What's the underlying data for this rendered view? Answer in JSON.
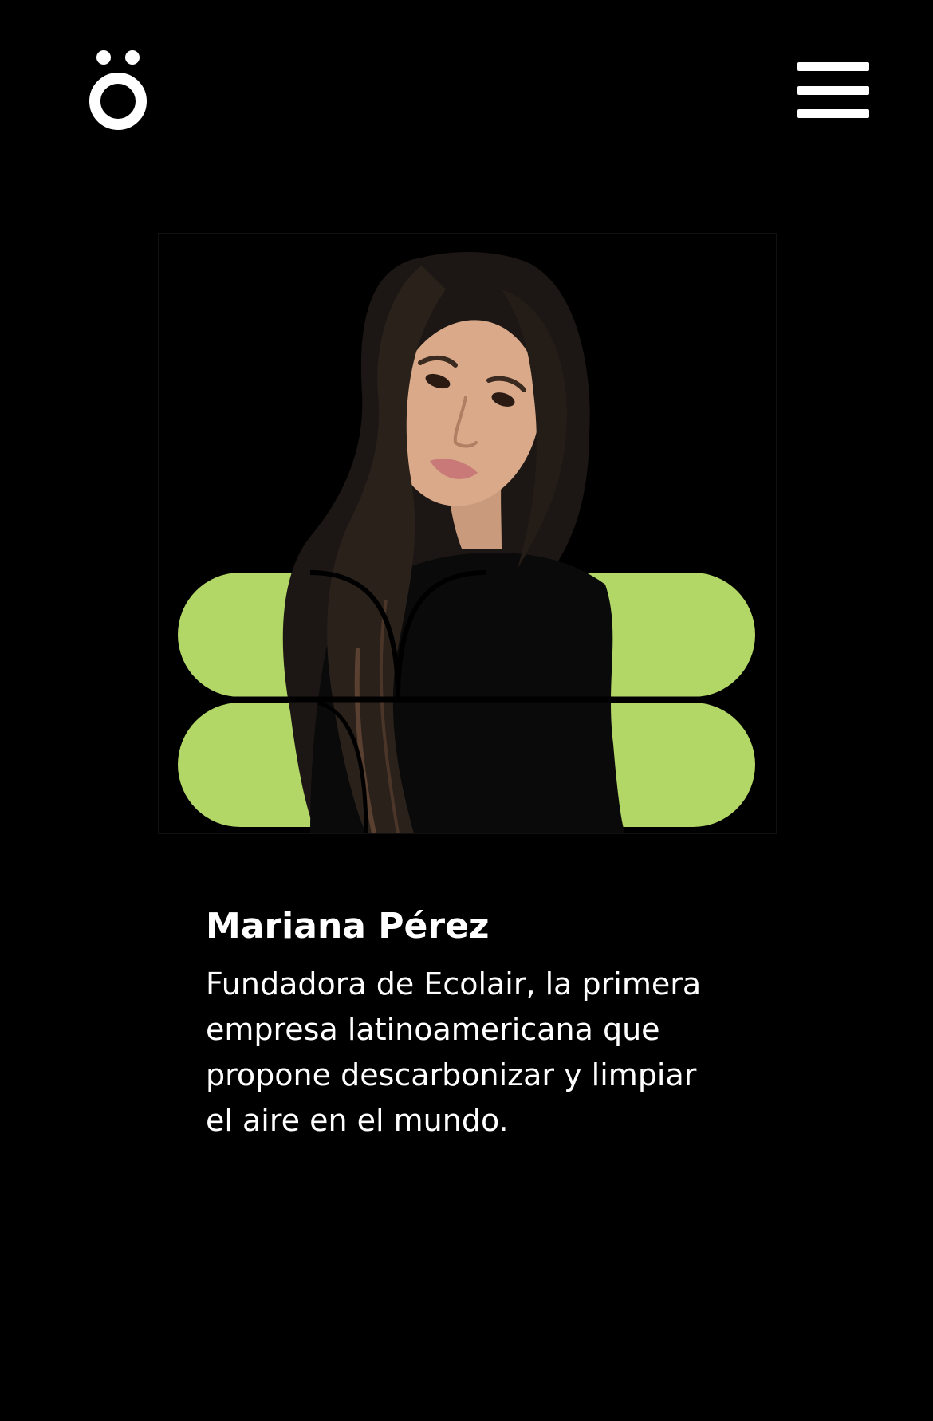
{
  "header": {
    "logo_icon": "o-umlaut-logo-icon",
    "menu_icon": "hamburger-menu-icon"
  },
  "profile": {
    "photo_icon": "portrait-photo",
    "accent_color": "#b3d766",
    "name": "Mariana Pérez",
    "description": "Fundadora de Ecolair, la primera empresa latinoamericana que propone descarbonizar y limpiar el aire en el mundo."
  }
}
